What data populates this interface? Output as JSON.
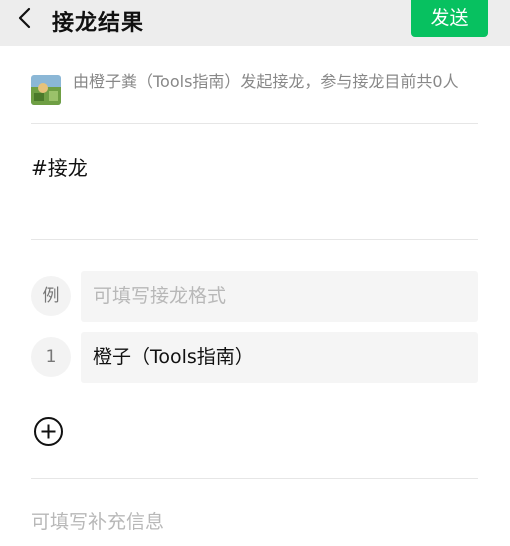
{
  "header": {
    "title": "接龙结果",
    "send_label": "发送"
  },
  "info": {
    "description": "由橙子粪（Tools指南）发起接龙，参与接龙目前共0人"
  },
  "topic": "#接龙",
  "example_row": {
    "badge": "例",
    "placeholder": "可填写接龙格式"
  },
  "entries": [
    {
      "index": "1",
      "value": "橙子（Tools指南）"
    }
  ],
  "supplement_placeholder": "可填写补充信息",
  "colors": {
    "accent": "#07c160",
    "topbar": "#ededed",
    "field_bg": "#f5f5f5",
    "placeholder": "#b8b8b8"
  },
  "icons": [
    "back-arrow-icon",
    "add-circle-icon",
    "avatar-image"
  ]
}
